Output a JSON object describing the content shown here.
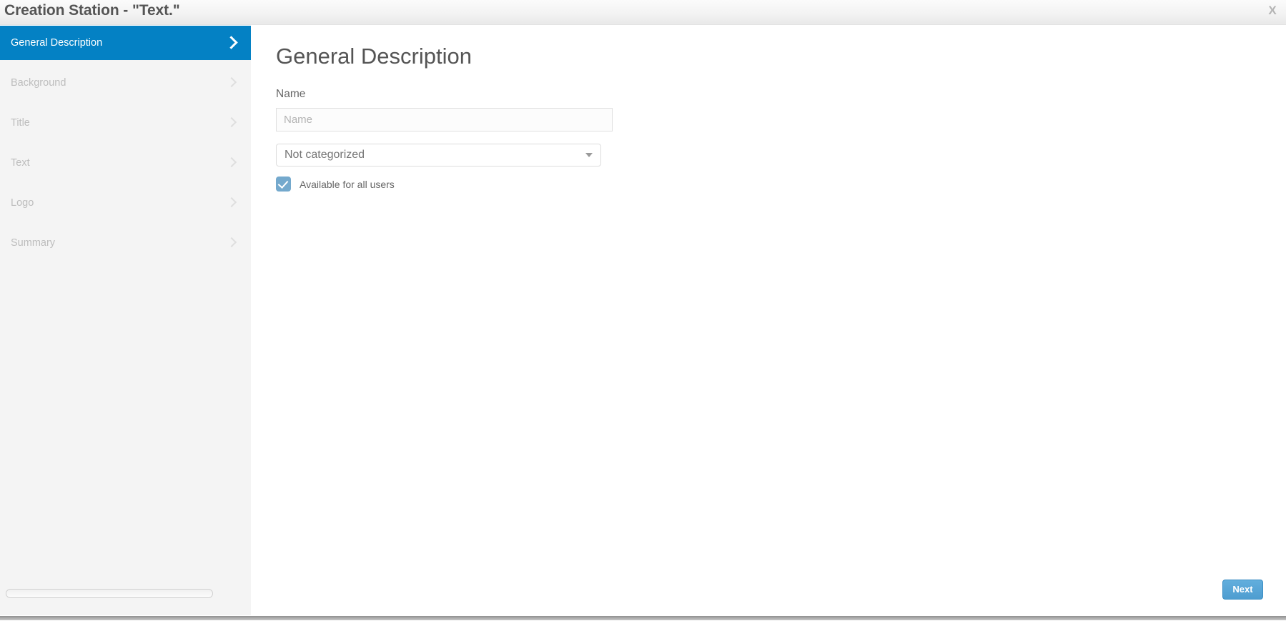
{
  "window": {
    "title": "Creation Station - \"Text.\"",
    "close_label": "X"
  },
  "sidebar": {
    "items": [
      {
        "label": "General Description",
        "active": true,
        "chevron": "chevron-right-icon"
      },
      {
        "label": "Background",
        "active": false,
        "chevron": "chevron-right-icon"
      },
      {
        "label": "Title",
        "active": false,
        "chevron": "chevron-right-icon"
      },
      {
        "label": "Text",
        "active": false,
        "chevron": "chevron-right-icon"
      },
      {
        "label": "Logo",
        "active": false,
        "chevron": "chevron-right-icon"
      },
      {
        "label": "Summary",
        "active": false,
        "chevron": "chevron-right-icon"
      }
    ],
    "active_color": "#0481c4",
    "background_color": "#f4f4f4",
    "inactive_text_color": "#bdbdbd"
  },
  "main": {
    "page_title": "General Description",
    "name_field": {
      "label": "Name",
      "placeholder": "Name",
      "value": ""
    },
    "category_select": {
      "selected": "Not categorized",
      "caret_icon": "chevron-down-icon"
    },
    "available_checkbox": {
      "label": "Available for all users",
      "checked": true,
      "color": "#74a9cd"
    }
  },
  "footer": {
    "next_label": "Next",
    "next_color": "#4e9dd0"
  }
}
